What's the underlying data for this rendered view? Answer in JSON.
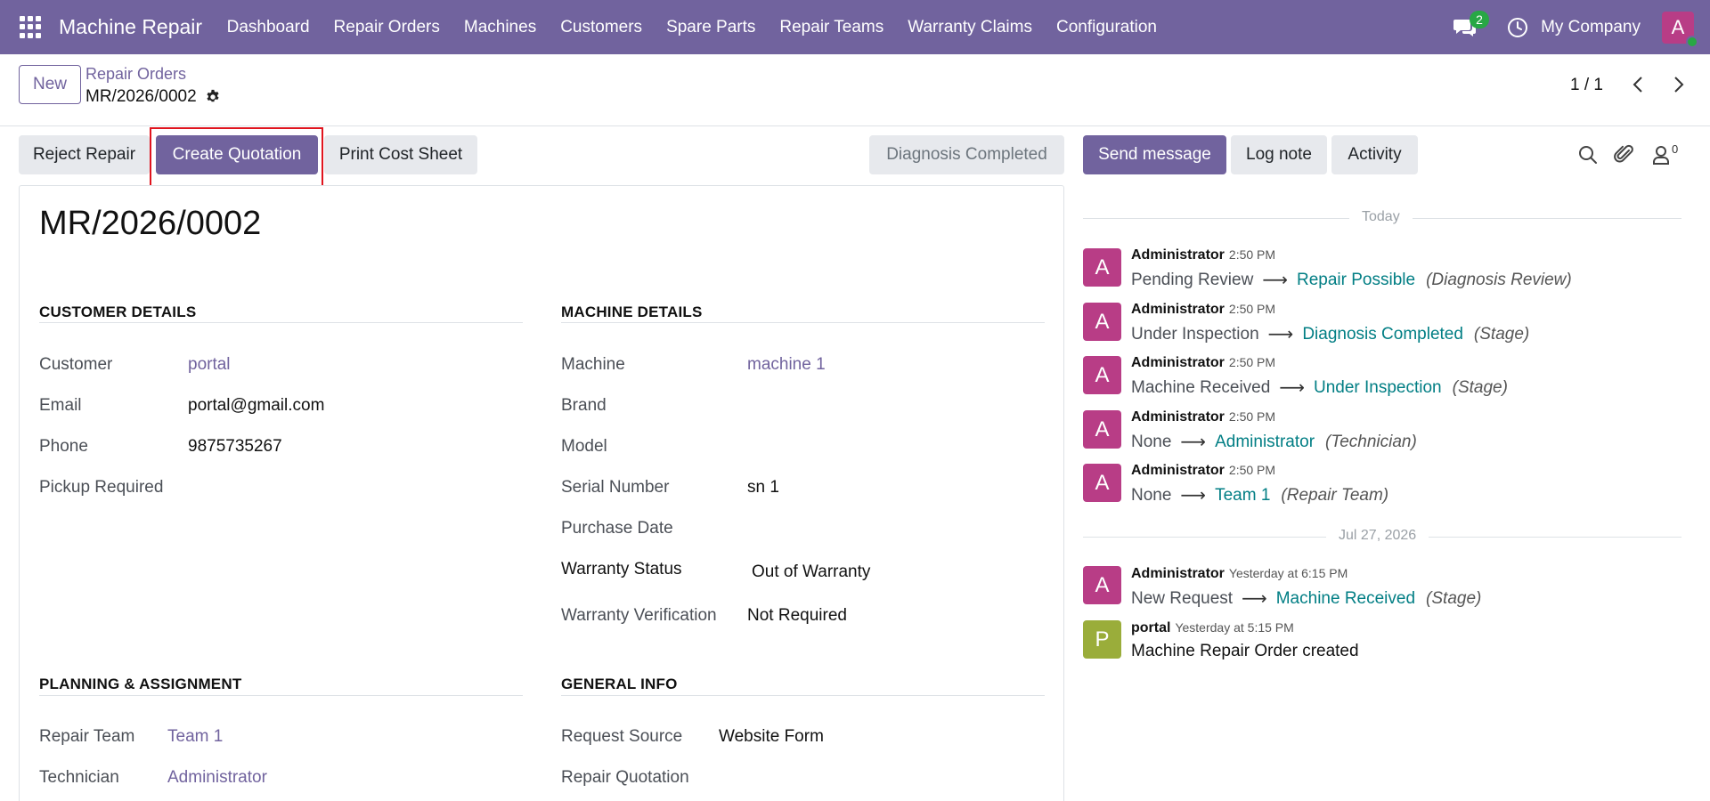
{
  "navbar": {
    "brand": "Machine Repair",
    "menu": [
      "Dashboard",
      "Repair Orders",
      "Machines",
      "Customers",
      "Spare Parts",
      "Repair Teams",
      "Warranty Claims",
      "Configuration"
    ],
    "chat_count": "2",
    "company": "My Company",
    "avatar_letter": "A",
    "accent_color": "#71639e"
  },
  "control": {
    "new_label": "New",
    "breadcrumb_parent": "Repair Orders",
    "breadcrumb_current": "MR/2026/0002",
    "pager": "1 / 1"
  },
  "statusbar": {
    "reject_label": "Reject Repair",
    "quotation_label": "Create Quotation",
    "print_label": "Print Cost Sheet",
    "stage_label": "Diagnosis Completed"
  },
  "chatter_buttons": {
    "send_label": "Send message",
    "log_label": "Log note",
    "activity_label": "Activity",
    "follower_count": "0"
  },
  "form": {
    "title": "MR/2026/0002",
    "customer_group": {
      "title": "CUSTOMER DETAILS",
      "customer_label": "Customer",
      "customer_value": "portal",
      "email_label": "Email",
      "email_value": "portal@gmail.com",
      "phone_label": "Phone",
      "phone_value": "9875735267",
      "pickup_label": "Pickup Required"
    },
    "machine_group": {
      "title": "MACHINE DETAILS",
      "machine_label": "Machine",
      "machine_value": "machine 1",
      "brand_label": "Brand",
      "model_label": "Model",
      "serial_label": "Serial Number",
      "serial_value": "sn 1",
      "purchase_label": "Purchase Date",
      "warranty_label": "Warranty Status",
      "warranty_value": "Out of Warranty",
      "verification_label": "Warranty Verification",
      "verification_value": "Not Required"
    },
    "planning_group": {
      "title": "PLANNING & ASSIGNMENT",
      "team_label": "Repair Team",
      "team_value": "Team 1",
      "technician_label": "Technician",
      "technician_value": "Administrator"
    },
    "general_group": {
      "title": "GENERAL INFO",
      "source_label": "Request Source",
      "source_value": "Website Form",
      "quotation_label": "Repair Quotation"
    }
  },
  "chatter": {
    "today_label": "Today",
    "date_label": "Jul 27, 2026",
    "messages": [
      {
        "avatar": "A",
        "author": "Administrator",
        "time": "2:50 PM",
        "old": "Pending Review",
        "new": "Repair Possible",
        "field": "(Diagnosis Review)"
      },
      {
        "avatar": "A",
        "author": "Administrator",
        "time": "2:50 PM",
        "old": "Under Inspection",
        "new": "Diagnosis Completed",
        "field": "(Stage)"
      },
      {
        "avatar": "A",
        "author": "Administrator",
        "time": "2:50 PM",
        "old": "Machine Received",
        "new": "Under Inspection",
        "field": "(Stage)"
      },
      {
        "avatar": "A",
        "author": "Administrator",
        "time": "2:50 PM",
        "old": "None",
        "new": "Administrator",
        "field": "(Technician)"
      },
      {
        "avatar": "A",
        "author": "Administrator",
        "time": "2:50 PM",
        "old": "None",
        "new": "Team 1",
        "field": "(Repair Team)"
      },
      {
        "avatar": "A",
        "author": "Administrator",
        "time": "Yesterday at 6:15 PM",
        "old": "New Request",
        "new": "Machine Received",
        "field": "(Stage)"
      },
      {
        "avatar": "P",
        "author": "portal",
        "time": "Yesterday at 5:15 PM",
        "body": "Machine Repair Order created"
      }
    ]
  }
}
